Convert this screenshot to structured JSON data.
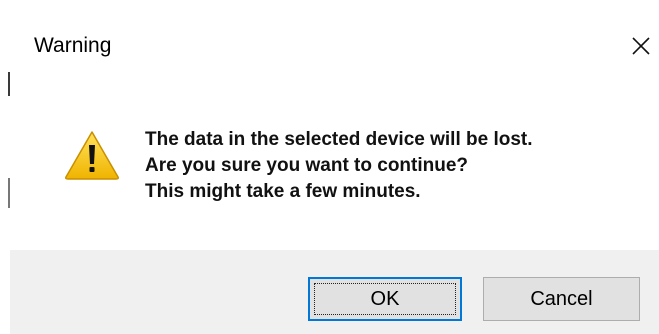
{
  "window": {
    "title": "Warning"
  },
  "message": {
    "lines": [
      "The data in the selected device will be lost.",
      "Are you sure you want to continue?",
      "This might take a few minutes."
    ]
  },
  "buttons": {
    "ok_label": "OK",
    "cancel_label": "Cancel"
  },
  "icons": {
    "close": "close-icon",
    "warning": "warning-icon"
  },
  "colors": {
    "footer_bg": "#f0f0f0",
    "button_bg": "#e1e1e1",
    "default_button_border": "#0078d7",
    "warning_yellow": "#f4c20d"
  }
}
